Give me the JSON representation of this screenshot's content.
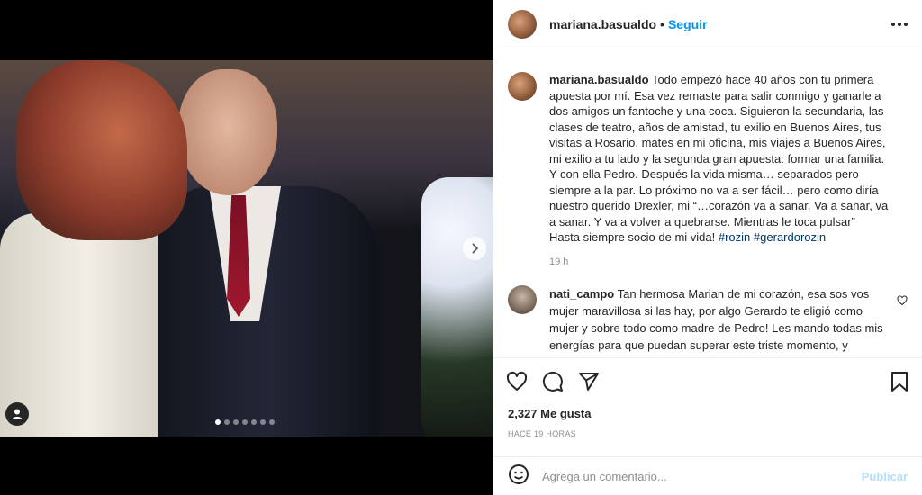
{
  "post": {
    "username": "mariana.basualdo",
    "follow_label": "Seguir",
    "header_separator": "•",
    "caption": {
      "username": "mariana.basualdo",
      "text": "Todo empezó hace 40 años con tu primera apuesta por mí. Esa vez remaste para salir conmigo y ganarle a dos amigos un fantoche y una coca. Siguieron la secundaria, las clases de teatro, años de amistad, tu exilio en Buenos Aires, tus visitas a Rosario, mates en mi oficina, mis viajes a Buenos Aires, mi exilio a tu lado y la segunda gran apuesta: formar una familia. Y con ella Pedro. Después la vida misma… separados pero siempre a la par. Lo próximo no va a ser fácil… pero como diría nuestro querido Drexler, mi “…corazón va a sanar. Va a sanar, va a sanar. Y va a volver a quebrarse. Mientras le toca pulsar”",
      "last_line": "Hasta siempre socio de mi vida!",
      "hashtags": [
        "#rozin",
        "#gerardorozin"
      ],
      "time": "19 h"
    },
    "comments": [
      {
        "username": "nati_campo",
        "text": "Tan hermosa Marian de mi corazón, esa sos vos mujer maravillosa si las hay, por algo Gerardo te eligió como mujer y sobre todo como madre de Pedro! Les mando todas mis energías para que puedan superar este triste momento, y"
      }
    ],
    "likes": "2,327 Me gusta",
    "posted_ago": "HACE 19 HORAS",
    "comment_placeholder": "Agrega un comentario...",
    "publish_label": "Publicar",
    "carousel": {
      "total": 7,
      "active_index": 0
    }
  },
  "icons": {
    "more": "more-options-icon",
    "like": "heart-icon",
    "comment": "comment-icon",
    "share": "share-icon",
    "save": "bookmark-icon",
    "emoji": "emoji-icon",
    "next": "chevron-right-icon",
    "tags": "user-tag-icon"
  },
  "colors": {
    "accent": "#0095f6",
    "hashtag": "#00376b",
    "publish_disabled": "#b2dffc",
    "muted": "#8e8e8e"
  }
}
